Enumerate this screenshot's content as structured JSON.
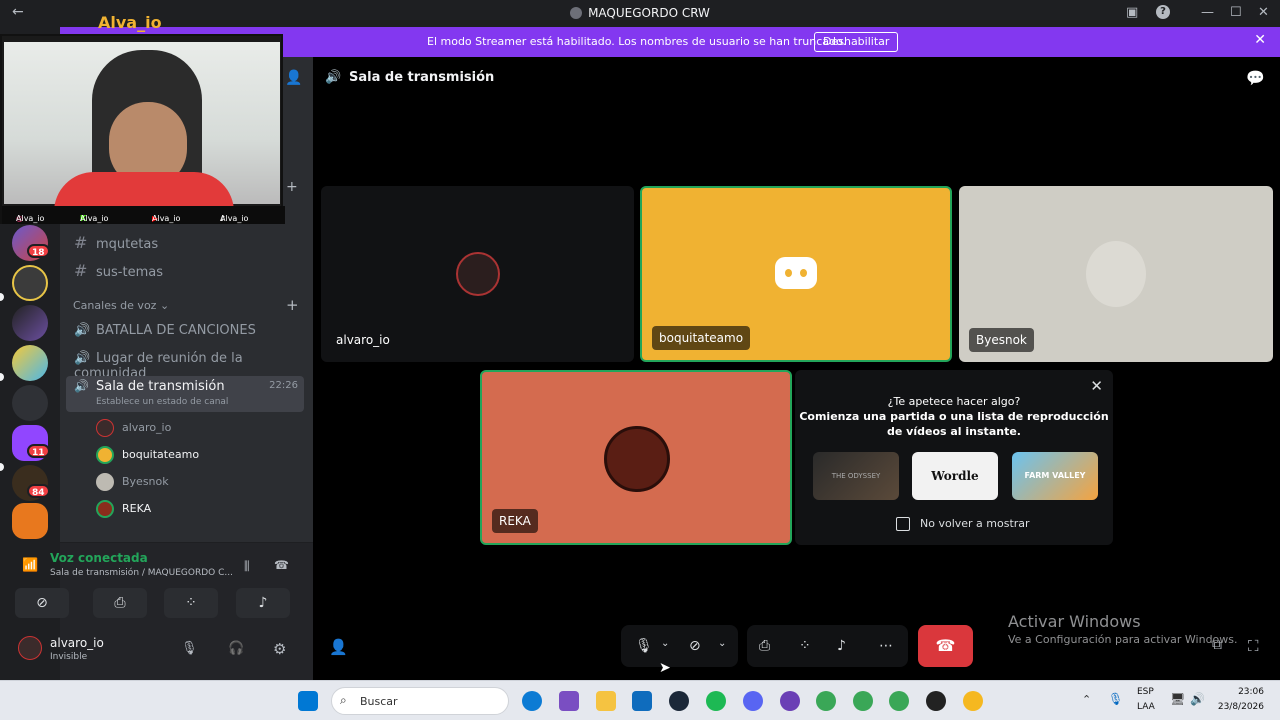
{
  "window": {
    "title": "MAQUEGORDO CRW",
    "back_icon": "←",
    "inbox_icon": "▣",
    "help_icon": "?",
    "min": "—",
    "max": "☐",
    "close": "✕"
  },
  "banner": {
    "text": "El modo Streamer está habilitado. Los nombres de usuario se han truncado.",
    "button": "Deshabilitar",
    "close": "✕",
    "color": "#8338f0"
  },
  "overlay": {
    "stream_name": "Alva_io",
    "socials": [
      "Alva_io",
      "Alva_io",
      "Alva_io",
      "Alva_io"
    ]
  },
  "rail": {
    "badges": [
      "18",
      "11",
      "84"
    ]
  },
  "sidebar": {
    "text_channels": [
      "mqutetas",
      "sus-temas"
    ],
    "voice_category": "Canales de voz",
    "voice_channels": [
      "BATALLA DE CANCIONES",
      "Lugar de reunión de la comunidad"
    ],
    "active_channel": {
      "name": "Sala de transmisión",
      "time": "22:26",
      "status": "Establece un estado de canal"
    },
    "members": [
      "alvaro_io",
      "boquitateamo",
      "Byesnok",
      "REKA"
    ],
    "voice_connected": {
      "title": "Voz conectada",
      "subtitle": "Sala de transmisión / MAQUEGORDO C..."
    },
    "user": {
      "name": "alvaro_io",
      "status": "Invisible"
    }
  },
  "main": {
    "header": "Sala de transmisión",
    "tiles": [
      {
        "name": "alvaro_io",
        "bg": "#111214"
      },
      {
        "name": "boquitateamo",
        "bg": "#f0b232"
      },
      {
        "name": "Byesnok",
        "bg": "#cfcdc5"
      },
      {
        "name": "REKA",
        "bg": "#d46b4f"
      }
    ],
    "activity": {
      "line1": "¿Te apetece hacer algo?",
      "line2": "Comienza una partida o una lista de reproducción",
      "line3": "de vídeos al instante.",
      "games": [
        "THE ODYSSEY",
        "Wordle",
        "FARM VALLEY"
      ],
      "checkbox_label": "No volver a mostrar"
    }
  },
  "watermark": {
    "line1": "Activar Windows",
    "line2": "Ve a Configuración para activar Windows."
  },
  "taskbar": {
    "search_placeholder": "Buscar",
    "lang1": "ESP",
    "lang2": "LAA",
    "time": "23:06",
    "date": "23/8/2026"
  }
}
